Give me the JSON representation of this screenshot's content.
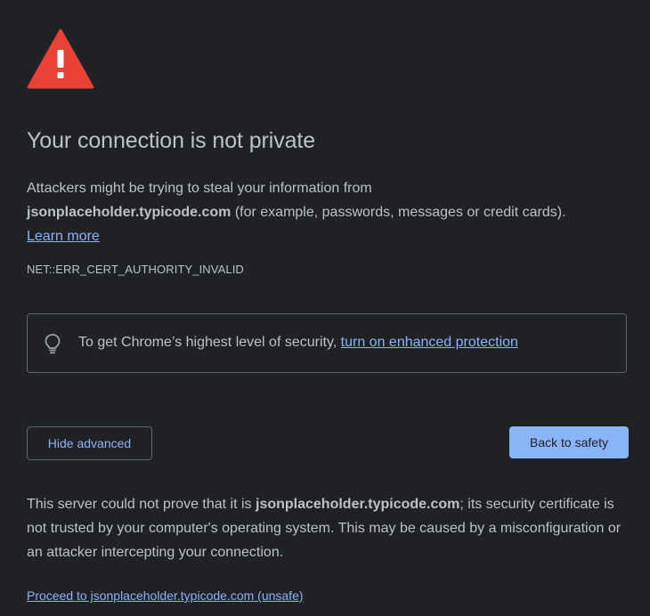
{
  "interstitial": {
    "heading": "Your connection is not private",
    "explanation": {
      "line1": "Attackers might be trying to steal your information from",
      "host": "jsonplaceholder.typicode.com",
      "line2": " (for example, passwords, messages or credit cards).",
      "learn_more": "Learn more"
    },
    "error_code": "NET::ERR_CERT_AUTHORITY_INVALID",
    "enhanced_protection": {
      "text": "To get Chrome’s highest level of security, ",
      "link": "turn on enhanced protection"
    },
    "buttons": {
      "hide_advanced": "Hide advanced",
      "back_to_safety": "Back to safety"
    },
    "details": {
      "part1": "This server could not prove that it is ",
      "host": "jsonplaceholder.typicode.com",
      "part2": "; its security certificate is not trusted by your computer's operating system. This may be caused by a misconfiguration or an attacker intercepting your connection."
    },
    "proceed_link": "Proceed to jsonplaceholder.typicode.com (unsafe)"
  },
  "icons": {
    "warning": "warning-triangle-icon",
    "bulb": "lightbulb-icon"
  },
  "colors": {
    "background": "#202124",
    "text": "#bdc1c6",
    "link": "#8ab4f8",
    "warning_red": "#e94235",
    "border": "#5f6368"
  }
}
